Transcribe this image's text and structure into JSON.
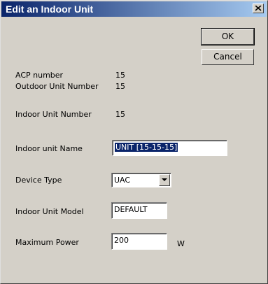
{
  "window": {
    "title": "Edit an Indoor Unit"
  },
  "buttons": {
    "ok": "OK",
    "cancel": "Cancel"
  },
  "fields": {
    "acp_number": {
      "label": "ACP number",
      "value": "15"
    },
    "outdoor_unit_number": {
      "label": "Outdoor Unit Number",
      "value": "15"
    },
    "indoor_unit_number": {
      "label": "Indoor Unit Number",
      "value": "15"
    },
    "indoor_unit_name": {
      "label": "Indoor unit Name",
      "value": "UNIT [15-15-15]"
    },
    "device_type": {
      "label": "Device Type",
      "value": "UAC"
    },
    "indoor_unit_model": {
      "label": "Indoor Unit Model",
      "value": "DEFAULT"
    },
    "maximum_power": {
      "label": "Maximum Power",
      "value": "200",
      "unit": "W"
    }
  },
  "icons": {
    "close": "close-icon",
    "dropdown": "chevron-down-icon"
  }
}
